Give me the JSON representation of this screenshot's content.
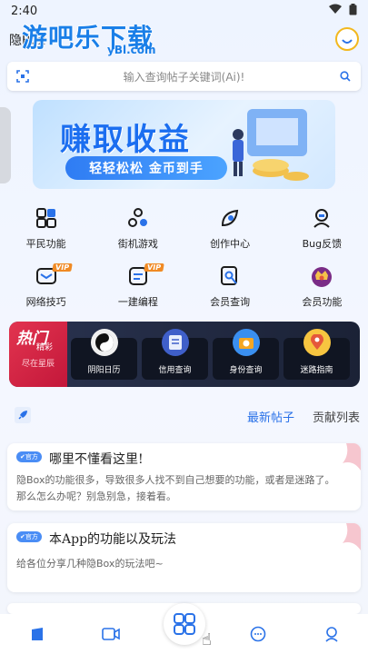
{
  "status": {
    "time": "2:40"
  },
  "header": {
    "app_title": "隐Box",
    "watermark_main": "游吧乐下载",
    "watermark_sub": "yBl.com"
  },
  "search": {
    "placeholder": "输入查询帖子关键词(Ai)!"
  },
  "banner": {
    "title": "赚取收益",
    "subtitle": "轻轻松松 金币到手"
  },
  "features": [
    {
      "label": "平民功能",
      "icon": "puzzle-icon"
    },
    {
      "label": "街机游戏",
      "icon": "gamepad-icon"
    },
    {
      "label": "创作中心",
      "icon": "leaf-icon"
    },
    {
      "label": "Bug反馈",
      "icon": "user-support-icon"
    },
    {
      "label": "网络技巧",
      "icon": "mail-icon",
      "vip": "VIP"
    },
    {
      "label": "一建编程",
      "icon": "code-doc-icon",
      "vip": "VIP"
    },
    {
      "label": "会员查询",
      "icon": "search-doc-icon"
    },
    {
      "label": "会员功能",
      "icon": "crown-badge-icon"
    }
  ],
  "hot": {
    "title": "热门",
    "tag": "精彩",
    "caption": "尽在星辰",
    "items": [
      {
        "label": "阴阳日历",
        "icon": "yin-yang-icon"
      },
      {
        "label": "信用查询",
        "icon": "book-icon"
      },
      {
        "label": "身份查询",
        "icon": "camera-icon"
      },
      {
        "label": "迷路指南",
        "icon": "map-pin-icon"
      }
    ]
  },
  "tabs": {
    "active": "最新帖子",
    "other": "贡献列表"
  },
  "posts": [
    {
      "badge": "✔官方",
      "title": "哪里不懂看这里!",
      "body": "隐Box的功能很多，导致很多人找不到自己想要的功能，或者是迷路了。那么怎么办呢？别急别急，接着看。"
    },
    {
      "badge": "✔官方",
      "title": "本App的功能以及玩法",
      "body": "给各位分享几种隐Box的玩法吧~"
    }
  ],
  "colors": {
    "accent": "#2a72e8",
    "vip": "#f08a24",
    "hot": "#d92442"
  }
}
